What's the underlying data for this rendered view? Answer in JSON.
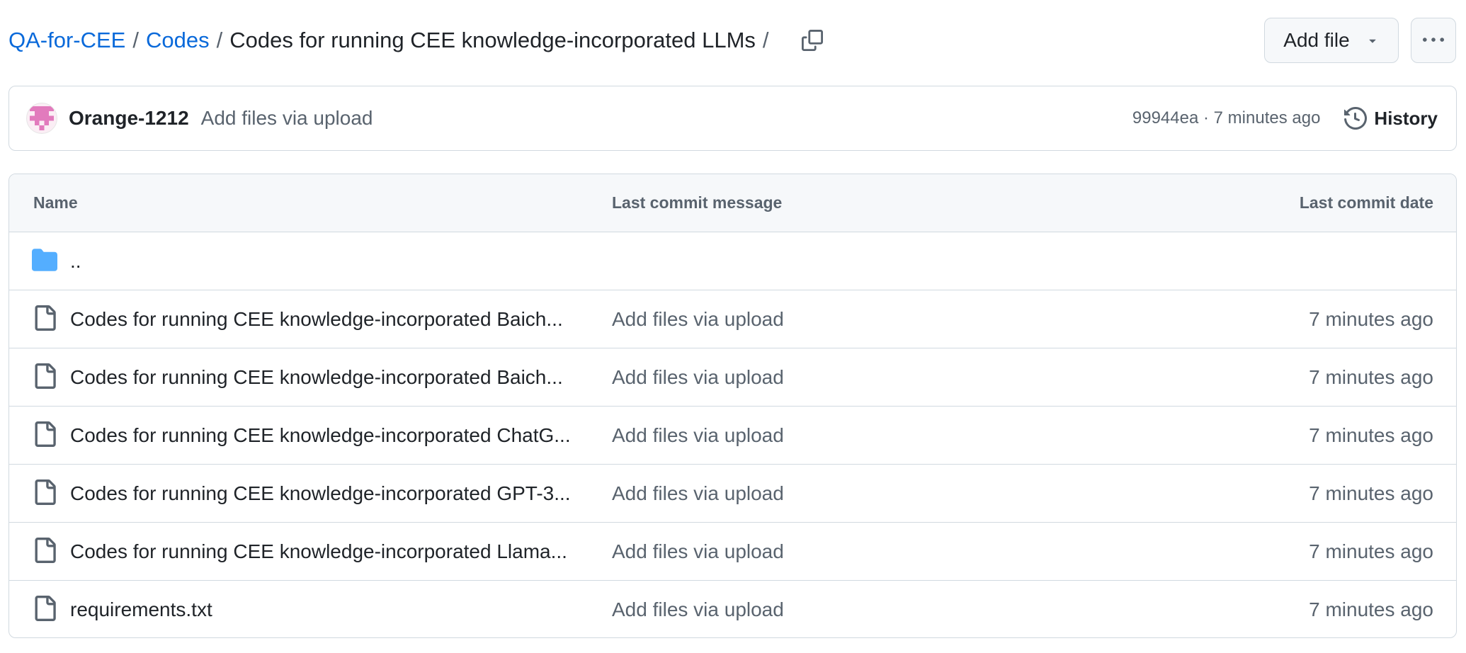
{
  "breadcrumb": {
    "repo": "QA-for-CEE",
    "folder": "Codes",
    "current": "Codes for running CEE knowledge-incorporated LLMs",
    "separator": "/"
  },
  "actions": {
    "add_file_label": "Add file"
  },
  "latest_commit": {
    "author": "Orange-1212",
    "message": "Add files via upload",
    "sha": "99944ea",
    "dot": "·",
    "time": "7 minutes ago",
    "history_label": "History"
  },
  "table": {
    "headers": {
      "name": "Name",
      "message": "Last commit message",
      "date": "Last commit date"
    },
    "parent_dir": "..",
    "rows": [
      {
        "name": "Codes for running CEE knowledge-incorporated Baich...",
        "message": "Add files via upload",
        "date": "7 minutes ago"
      },
      {
        "name": "Codes for running CEE knowledge-incorporated Baich...",
        "message": "Add files via upload",
        "date": "7 minutes ago"
      },
      {
        "name": "Codes for running CEE knowledge-incorporated ChatG...",
        "message": "Add files via upload",
        "date": "7 minutes ago"
      },
      {
        "name": "Codes for running CEE knowledge-incorporated GPT-3...",
        "message": "Add files via upload",
        "date": "7 minutes ago"
      },
      {
        "name": "Codes for running CEE knowledge-incorporated Llama...",
        "message": "Add files via upload",
        "date": "7 minutes ago"
      },
      {
        "name": "requirements.txt",
        "message": "Add files via upload",
        "date": "7 minutes ago"
      }
    ]
  },
  "colors": {
    "link": "#0969da",
    "muted": "#59636e",
    "border": "#d1d9e0",
    "folder": "#54aeff",
    "avatar": "#e27bbd"
  },
  "icons": {
    "copy": "copy-icon",
    "dropdown": "triangle-down-icon",
    "more": "kebab-horizontal-icon",
    "history": "history-icon",
    "folder": "folder-icon",
    "file": "file-icon"
  }
}
